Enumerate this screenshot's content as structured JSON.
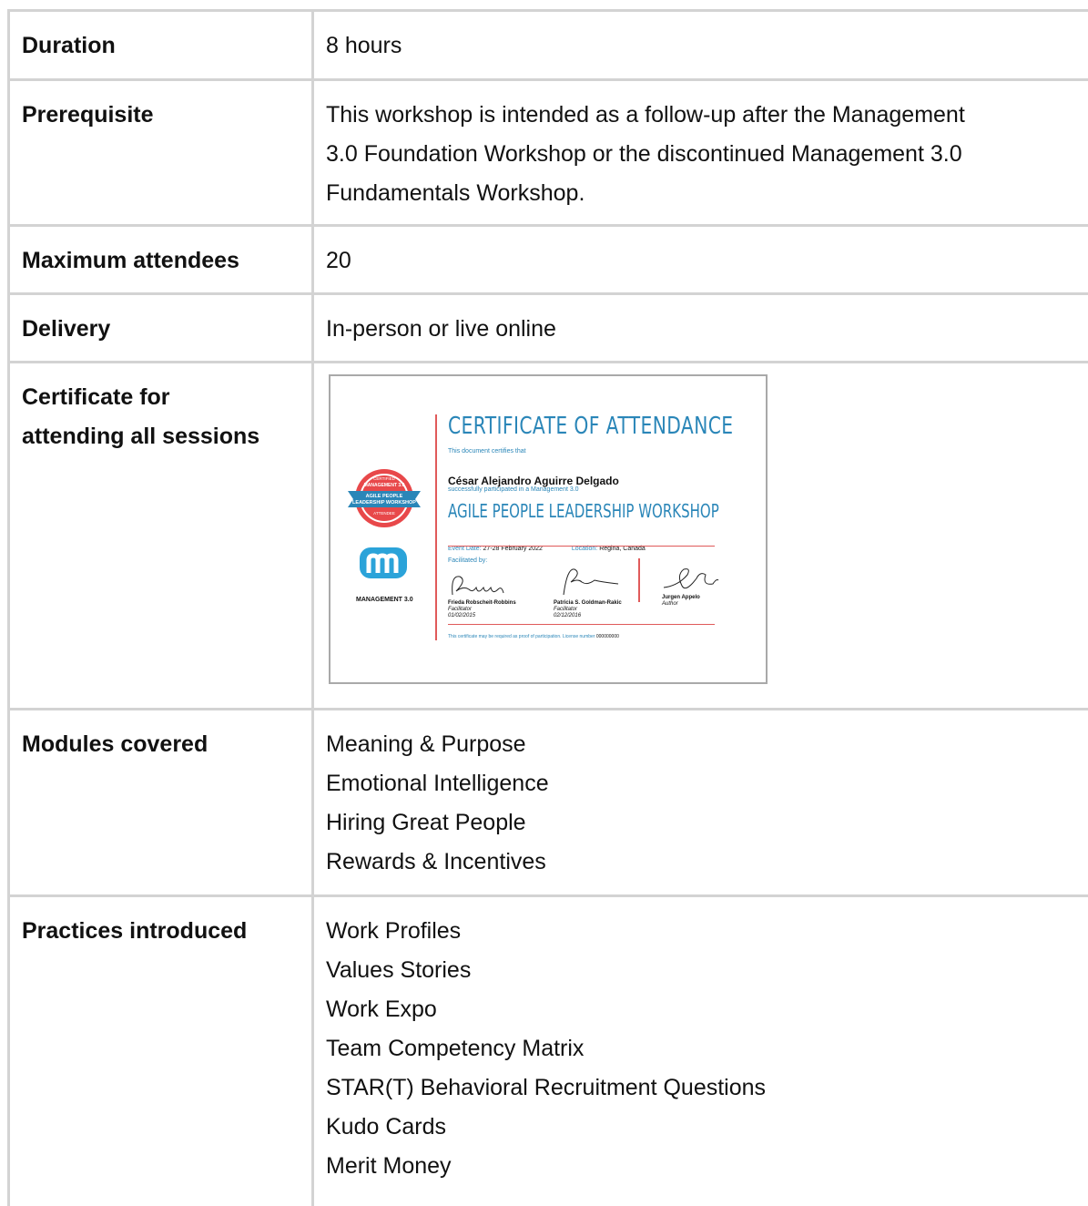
{
  "rows": [
    {
      "label": "Duration",
      "value": "8 hours"
    },
    {
      "label": "Prerequisite",
      "value_lines": [
        "This workshop is intended as a follow-up after the Management",
        "3.0 Foundation Workshop or the discontinued Management 3.0",
        "Fundamentals Workshop."
      ]
    },
    {
      "label": "Maximum attendees",
      "value": "20"
    },
    {
      "label": "Delivery",
      "value": "In-person or live online"
    },
    {
      "label_lines": [
        "Certificate for",
        "attending all sessions"
      ]
    },
    {
      "label": "Modules covered",
      "items": [
        "Meaning & Purpose",
        "Emotional Intelligence",
        "Hiring Great People",
        "Rewards & Incentives"
      ]
    },
    {
      "label": "Practices introduced",
      "items": [
        "Work Profiles",
        "Values Stories",
        "Work Expo",
        "Team Competency Matrix",
        "STAR(T) Behavioral Recruitment Questions",
        "Kudo Cards",
        "Merit Money"
      ]
    }
  ],
  "certificate": {
    "title": "CERTIFICATE OF ATTENDANCE",
    "certifies": "This document certifies that",
    "name": "César Alejandro Aguirre Delgado",
    "participated": "successfully participated in a Management 3.0",
    "workshop": "AGILE PEOPLE LEADERSHIP WORKSHOP",
    "event_label": "Event Date:",
    "event_value": "27-28 February 2022",
    "location_label": "Location:",
    "location_value": "Regina, Canada",
    "facilitated_by": "Facilitated by:",
    "signers": [
      {
        "name": "Frieda Robscheit-Robbins",
        "role": "Facilitator",
        "date": "01/02/2015"
      },
      {
        "name": "Patricia S. Goldman-Rakic",
        "role": "Facilitator",
        "date": "02/12/2016"
      },
      {
        "name": "Jurgen Appelo",
        "role": "Author"
      }
    ],
    "footer_text": "This certificate may be required as proof of participation. License number",
    "license_number": "000000000",
    "badge": {
      "line1": "CERTIFIED",
      "line2": "MANAGEMENT 3.0",
      "line3": "AGILE PEOPLE",
      "line4": "LEADERSHIP WORKSHOP",
      "line5": "ATTENDEE"
    },
    "logo_text": "MANAGEMENT 3.0",
    "colors": {
      "accent": "#2a86b8",
      "red": "#e05a5a",
      "badge_red": "#e8484a",
      "logo_blue": "#2ba3d9"
    }
  }
}
